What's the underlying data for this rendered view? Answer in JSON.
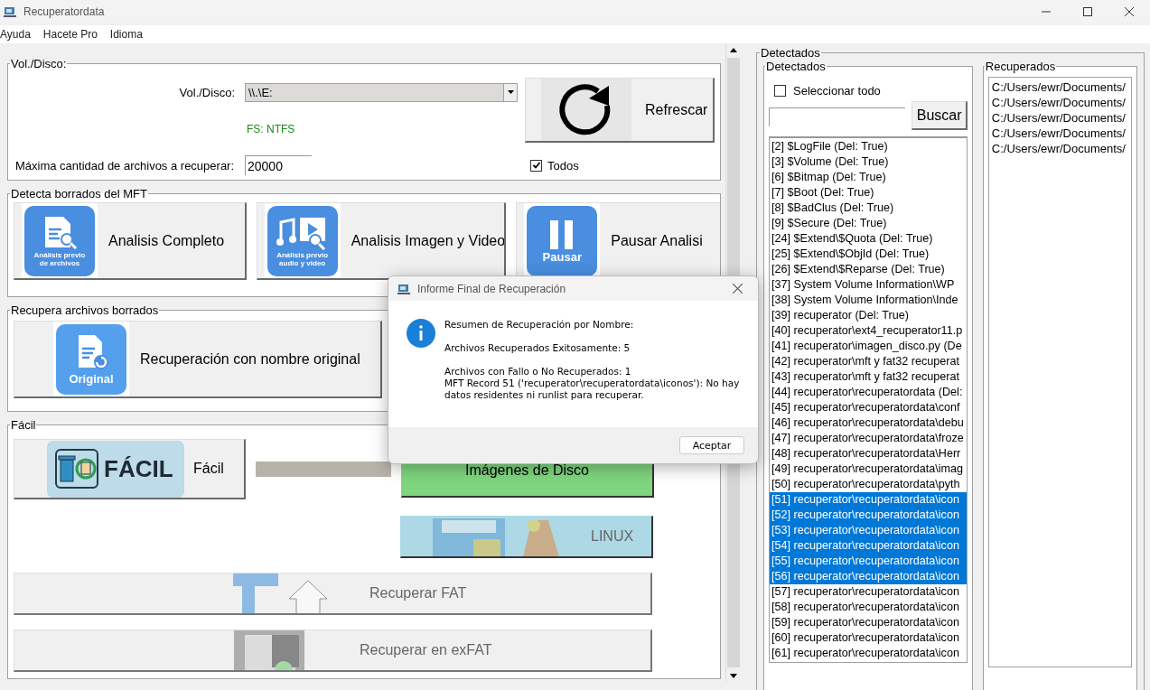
{
  "window": {
    "title": "Recuperatordata"
  },
  "menu": [
    "Ayuda",
    "Hacete Pro",
    "Idioma"
  ],
  "volume_group": {
    "title": "Vol./Disco:",
    "volume_label": "Vol./Disco:",
    "volume_value": "\\\\.\\E:",
    "fs": "FS: NTFS",
    "max_label": "Máxima cantidad de archivos a recuperar:",
    "max_value": "20000",
    "refresh_button": "Refrescar",
    "all_checkbox": {
      "label": "Todos",
      "checked": true
    }
  },
  "mft_group": {
    "title": "Detecta borrados del MFT",
    "buttons": [
      {
        "kind": "document",
        "label": "Analisis Completo",
        "icon_lines": [
          "Análisis previo",
          "de archivos"
        ]
      },
      {
        "kind": "media",
        "label": "Analisis Imagen y Video",
        "icon_lines": [
          "Análisis previo",
          "audio y video"
        ]
      },
      {
        "kind": "pause",
        "label": "Pausar Analisi",
        "icon_lines": [
          "Pausar"
        ]
      }
    ]
  },
  "recover_group": {
    "title": "Recupera archivos borrados",
    "button": {
      "label": "Recuperación con nombre original",
      "icon_lines": [
        "Original"
      ]
    }
  },
  "easy_group": {
    "title": "Fácil",
    "easy_button": {
      "label": "Fácil",
      "logo_text": "FÁCIL"
    },
    "disk_images_button": "Imágenes de Disco",
    "linux_button": "LINUX",
    "fat_button": "Recuperar FAT",
    "exfat_button": "Recuperar en exFAT"
  },
  "detected": {
    "title": "Detectados",
    "list_title": "Detectados",
    "select_all": {
      "label": "Seleccionar todo",
      "checked": false
    },
    "search_button": "Buscar",
    "items": [
      {
        "text": "[2] $LogFile (Del: True)",
        "selected": false
      },
      {
        "text": "[3] $Volume (Del: True)",
        "selected": false
      },
      {
        "text": "[6] $Bitmap (Del: True)",
        "selected": false
      },
      {
        "text": "[7] $Boot (Del: True)",
        "selected": false
      },
      {
        "text": "[8] $BadClus (Del: True)",
        "selected": false
      },
      {
        "text": "[9] $Secure (Del: True)",
        "selected": false
      },
      {
        "text": "[24] $Extend\\$Quota (Del: True)",
        "selected": false
      },
      {
        "text": "[25] $Extend\\$ObjId (Del: True)",
        "selected": false
      },
      {
        "text": "[26] $Extend\\$Reparse (Del: True)",
        "selected": false
      },
      {
        "text": "[37] System Volume Information\\WP",
        "selected": false
      },
      {
        "text": "[38] System Volume Information\\Inde",
        "selected": false
      },
      {
        "text": "[39] recuperator (Del: True)",
        "selected": false
      },
      {
        "text": "[40] recuperator\\ext4_recuperator11.p",
        "selected": false
      },
      {
        "text": "[41] recuperator\\imagen_disco.py (De",
        "selected": false
      },
      {
        "text": "[42] recuperator\\mft y fat32 recuperat",
        "selected": false
      },
      {
        "text": "[43] recuperator\\mft y fat32 recuperat",
        "selected": false
      },
      {
        "text": "[44] recuperator\\recuperatordata (Del:",
        "selected": false
      },
      {
        "text": "[45] recuperator\\recuperatordata\\conf",
        "selected": false
      },
      {
        "text": "[46] recuperator\\recuperatordata\\debu",
        "selected": false
      },
      {
        "text": "[47] recuperator\\recuperatordata\\froze",
        "selected": false
      },
      {
        "text": "[48] recuperator\\recuperatordata\\Herr",
        "selected": false
      },
      {
        "text": "[49] recuperator\\recuperatordata\\imag",
        "selected": false
      },
      {
        "text": "[50] recuperator\\recuperatordata\\pyth",
        "selected": false
      },
      {
        "text": "[51] recuperator\\recuperatordata\\icon",
        "selected": true
      },
      {
        "text": "[52] recuperator\\recuperatordata\\icon",
        "selected": true
      },
      {
        "text": "[53] recuperator\\recuperatordata\\icon",
        "selected": true
      },
      {
        "text": "[54] recuperator\\recuperatordata\\icon",
        "selected": true
      },
      {
        "text": "[55] recuperator\\recuperatordata\\icon",
        "selected": true
      },
      {
        "text": "[56] recuperator\\recuperatordata\\icon",
        "selected": true
      },
      {
        "text": "[57] recuperator\\recuperatordata\\icon",
        "selected": false
      },
      {
        "text": "[58] recuperator\\recuperatordata\\icon",
        "selected": false
      },
      {
        "text": "[59] recuperator\\recuperatordata\\icon",
        "selected": false
      },
      {
        "text": "[60] recuperator\\recuperatordata\\icon",
        "selected": false
      },
      {
        "text": "[61] recuperator\\recuperatordata\\icon",
        "selected": false
      }
    ]
  },
  "recovered": {
    "title": "Recuperados",
    "items": [
      "C:/Users/ewr/Documents/",
      "C:/Users/ewr/Documents/",
      "C:/Users/ewr/Documents/",
      "C:/Users/ewr/Documents/",
      "C:/Users/ewr/Documents/"
    ]
  },
  "dialog": {
    "title": "Informe Final de Recuperación",
    "paragraphs": [
      [
        "Resumen de Recuperación por Nombre:"
      ],
      [
        "Archivos Recuperados Exitosamente: 5"
      ],
      [
        "Archivos con Fallo o No Recuperados: 1",
        "MFT Record 51 ('recuperator\\recuperatordata\\iconos'): No hay datos residentes ni runlist para recuperar."
      ]
    ],
    "ok_button": "Aceptar"
  }
}
